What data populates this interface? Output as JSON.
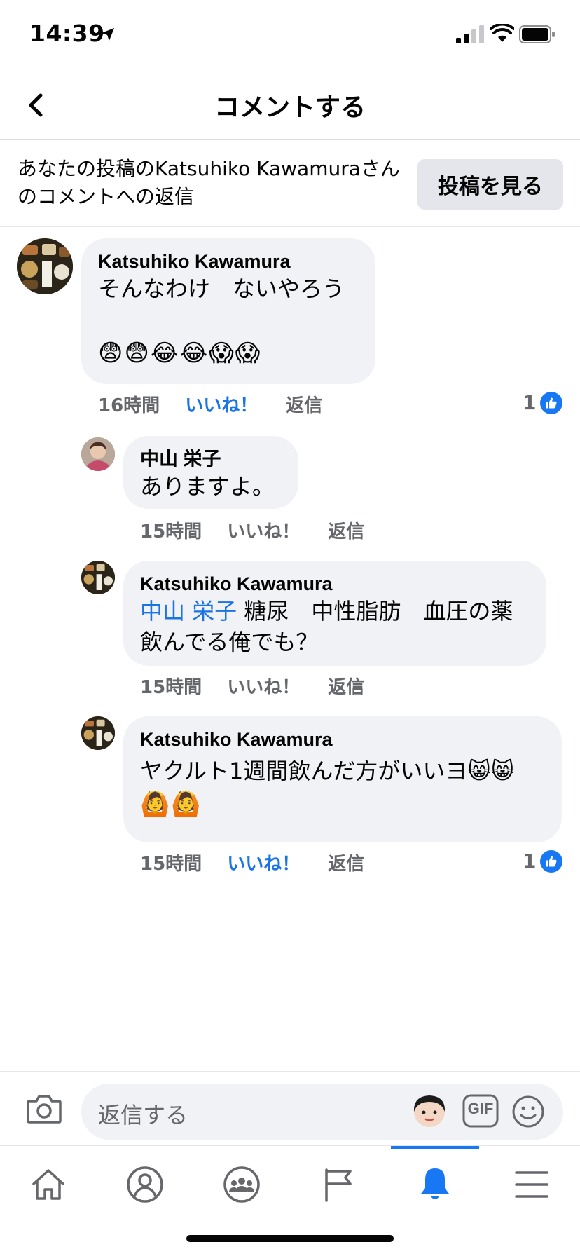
{
  "status_bar": {
    "time": "14:39"
  },
  "header": {
    "title": "コメントする"
  },
  "context": {
    "text": "あなたの投稿のKatsuhiko Kawamuraさんのコメントへの返信",
    "view_post_label": "投稿を見る"
  },
  "comments": [
    {
      "author": "Katsuhiko Kawamura",
      "text": "そんなわけ　ないやろう",
      "emoji": "😨😨😂😂😱😱",
      "time": "16時間",
      "like_label": "いいね！",
      "reply_label": "返信",
      "reactions": "1"
    },
    {
      "author": "中山 栄子",
      "text": "ありますよ。",
      "time": "15時間",
      "like_label": "いいね！",
      "reply_label": "返信"
    },
    {
      "author": "Katsuhiko Kawamura",
      "mention": "中山 栄子",
      "text": " 糖尿　中性脂肪　血圧の薬飲んでる俺でも？",
      "time": "15時間",
      "like_label": "いいね！",
      "reply_label": "返信"
    },
    {
      "author": "Katsuhiko Kawamura",
      "text": "ヤクルト1週間飲んだ方がいいヨ😸😸",
      "emoji": "🙆🙆",
      "time": "15時間",
      "like_label": "いいね！",
      "reply_label": "返信",
      "reactions": "1"
    }
  ],
  "composer": {
    "placeholder": "返信する",
    "gif_label": "GIF"
  },
  "tabs": [
    "home-icon",
    "profile-icon",
    "groups-icon",
    "pages-flag-icon",
    "notifications-bell-icon",
    "menu-icon"
  ],
  "colors": {
    "accent": "#1877f2",
    "link": "#1b74e4",
    "bubble": "#f0f2f5",
    "muted": "#65676b"
  }
}
